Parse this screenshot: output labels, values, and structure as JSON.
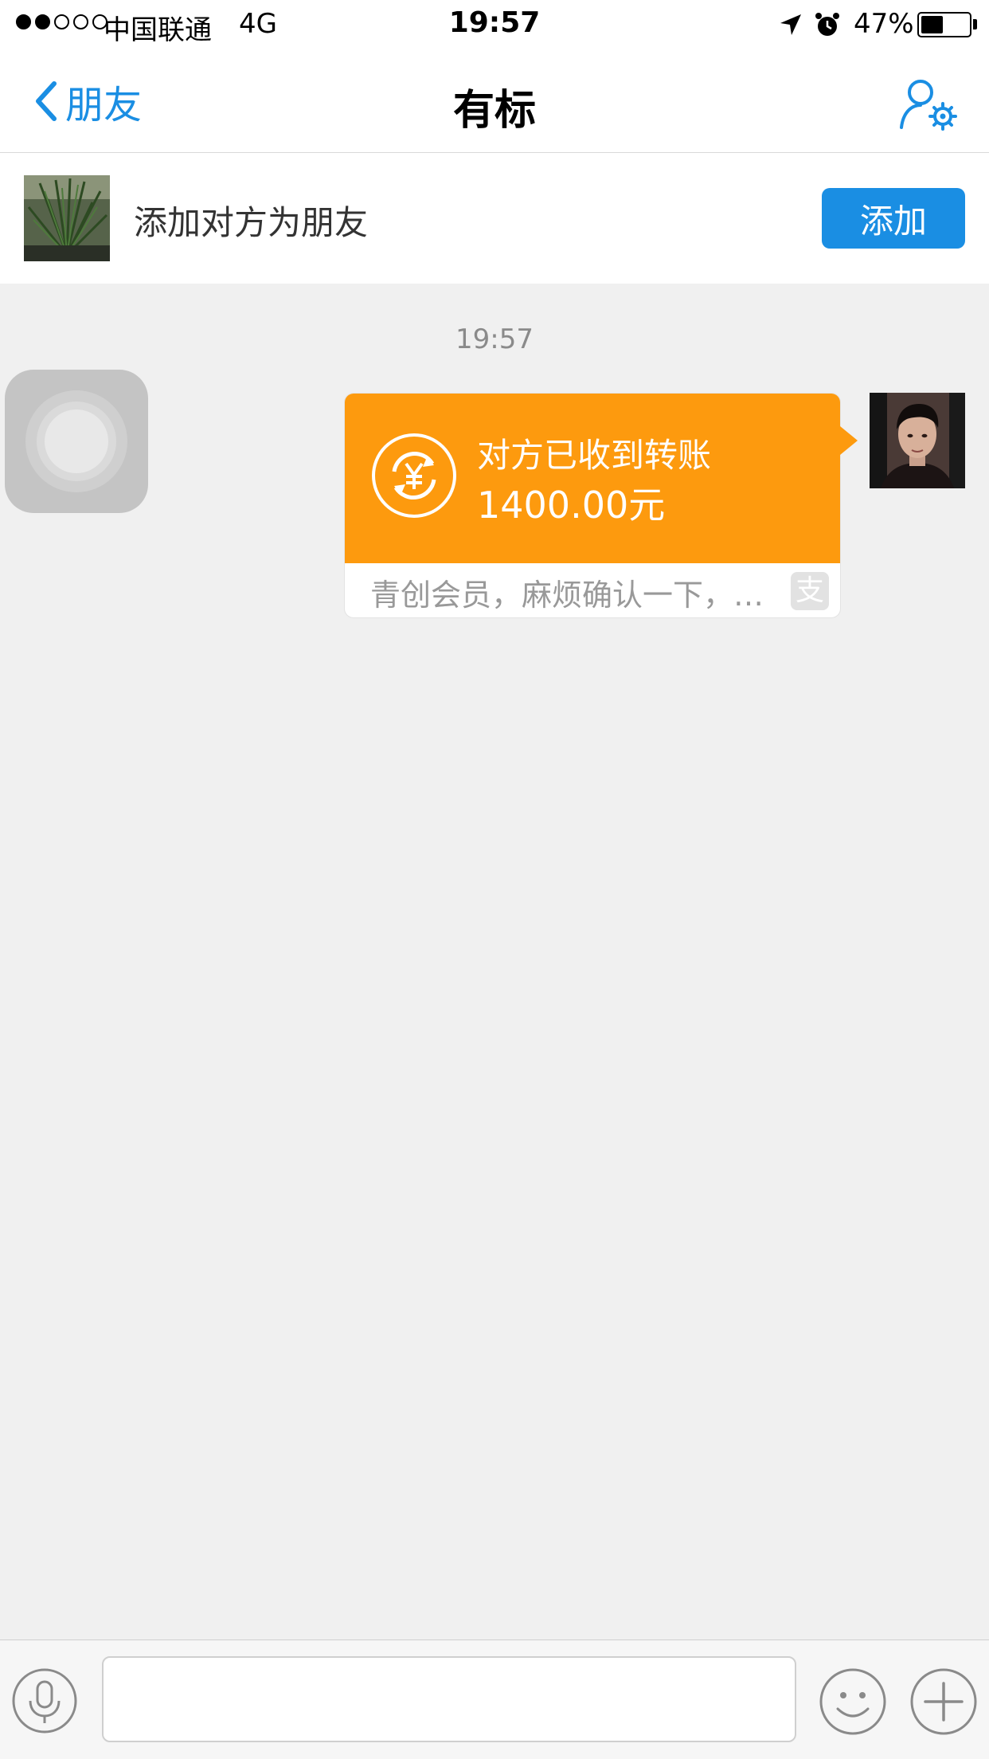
{
  "status_bar": {
    "carrier": "中国联通",
    "network": "4G",
    "time": "19:57",
    "battery": "47%",
    "battery_level": 0.47,
    "signal_bars_filled": 2,
    "signal_bars_total": 5
  },
  "nav": {
    "back_label": "朋友",
    "title": "有标",
    "accent_color": "#1a8ee3"
  },
  "add_friend": {
    "prompt": "添加对方为朋友",
    "button_label": "添加"
  },
  "chat": {
    "timestamp": "19:57",
    "transfer": {
      "status": "对方已收到转账",
      "amount": "1400.00元",
      "note": "青创会员，麻烦确认一下，…",
      "brand_mark": "支",
      "color": "#fd9a0e"
    }
  },
  "input_bar": {
    "placeholder": ""
  }
}
